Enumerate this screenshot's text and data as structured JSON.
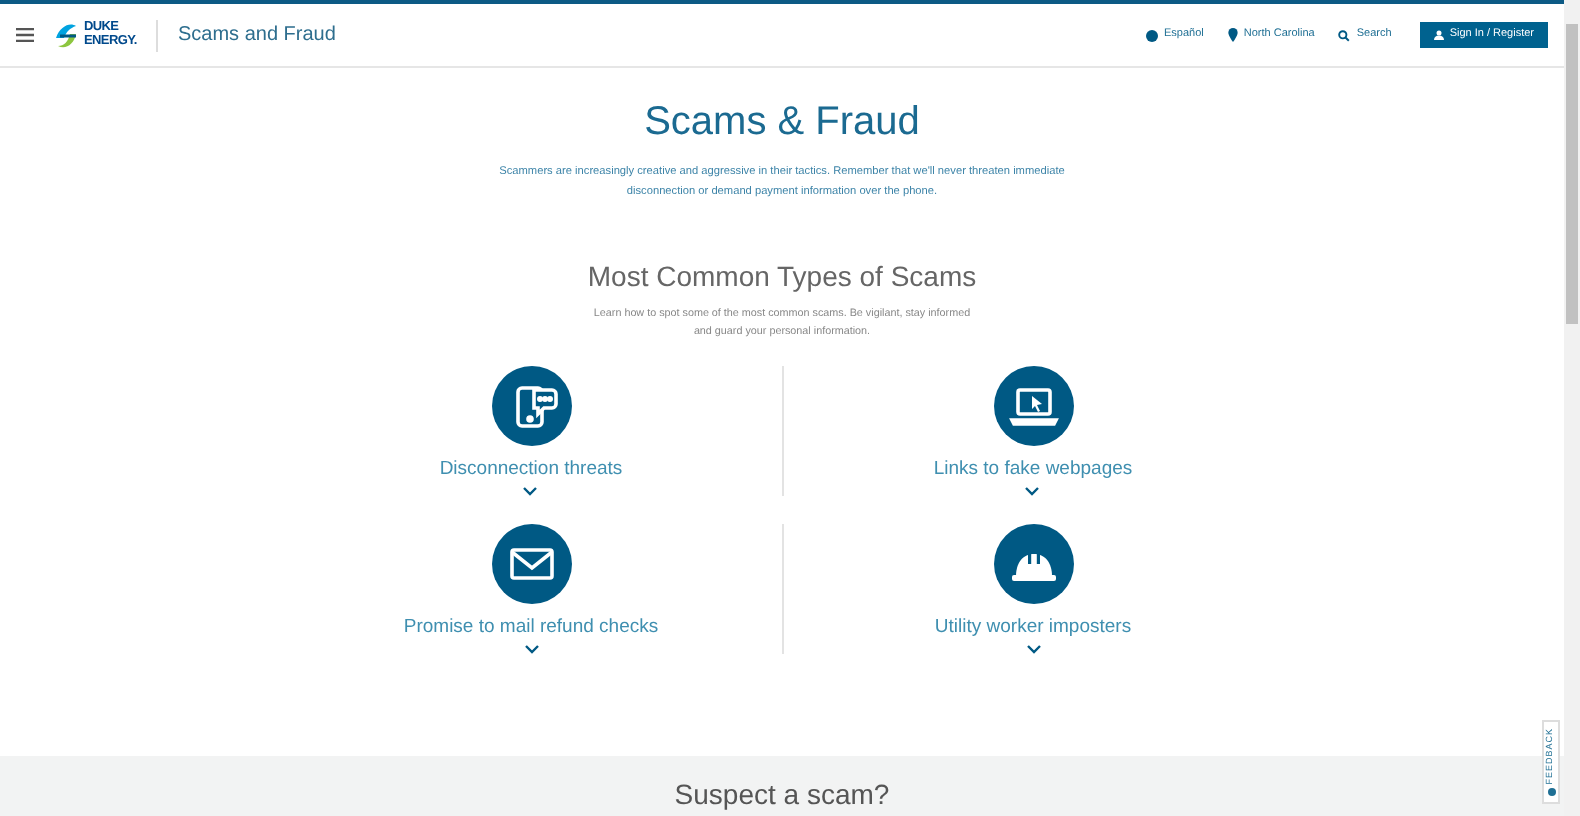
{
  "header": {
    "logo_text": "DUKE ENERGY.",
    "site_title": "Scams and Fraud",
    "links": [
      {
        "kind": "language",
        "label": "Español"
      },
      {
        "kind": "location",
        "label": "North Carolina"
      },
      {
        "kind": "search",
        "label": "Search"
      }
    ],
    "sign_in": "Sign In / Register"
  },
  "hero": {
    "title": "Scams & Fraud",
    "text": "Scammers are increasingly creative and aggressive in their tactics. Remember that we'll never threaten immediate disconnection or demand payment information over the phone."
  },
  "types": {
    "title": "Most Common Types of Scams",
    "text": "Learn how to spot some of the most common scams. Be vigilant, stay informed and guard your personal information.",
    "items": [
      {
        "kind": "phone",
        "label": "Disconnection threats",
        "expanded": false
      },
      {
        "kind": "laptop",
        "label": "Links to fake webpages",
        "expanded": false
      },
      {
        "kind": "mail",
        "label": "Promise to mail refund checks",
        "expanded": false
      },
      {
        "kind": "hardhat",
        "label": "Utility worker imposters",
        "expanded": false
      }
    ]
  },
  "suspect": {
    "title": "Suspect a scam?"
  },
  "feedback": "FEEDBACK"
}
